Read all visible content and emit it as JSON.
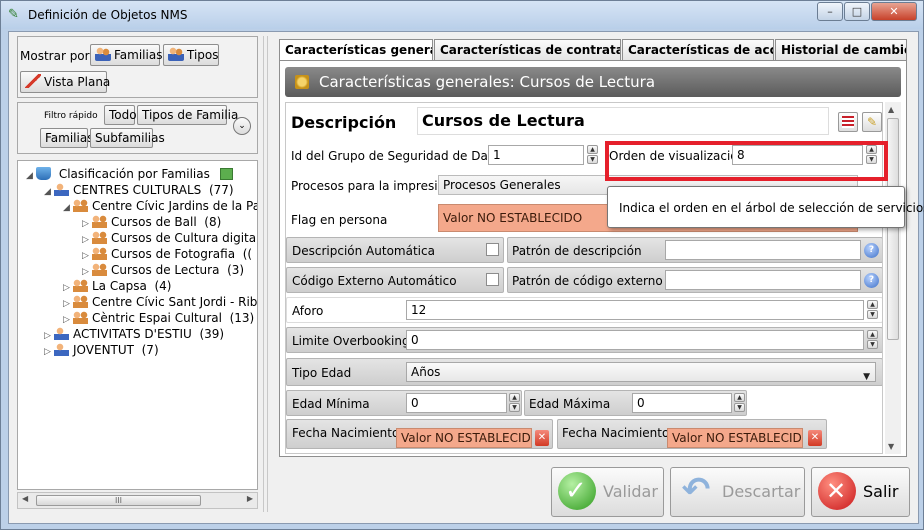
{
  "window": {
    "title": "Definición de Objetos NMS",
    "buttons": {
      "minimize": "–",
      "maximize": "□",
      "close": "✕"
    }
  },
  "left_panel": {
    "mostrar_por_label": "Mostrar por:",
    "familias_button": "Familias",
    "tipos_button": "Tipos",
    "vista_plana_button": "Vista Plana",
    "filtro_rapido_label": "Filtro rápido",
    "filter_buttons": [
      "Todo",
      "Tipos de Familia",
      "Familias",
      "Subfamilias"
    ],
    "tree": [
      {
        "label": "Clasificación por Familias",
        "count": ""
      },
      {
        "label": "CENTRES CULTURALS",
        "count": "(77)"
      },
      {
        "label": "Centre Cívic Jardins de la Pa",
        "count": ""
      },
      {
        "label": "Cursos de Ball",
        "count": "(8)"
      },
      {
        "label": "Cursos de Cultura digita",
        "count": ""
      },
      {
        "label": "Cursos de Fotografia",
        "count": "(("
      },
      {
        "label": "Cursos de Lectura",
        "count": "(3)"
      },
      {
        "label": "La Capsa",
        "count": "(4)"
      },
      {
        "label": "Centre Cívic Sant Jordi - Rib",
        "count": ""
      },
      {
        "label": "Cèntric Espai Cultural",
        "count": "(13)"
      },
      {
        "label": "ACTIVITATS D'ESTIU",
        "count": "(39)"
      },
      {
        "label": "JOVENTUT",
        "count": "(7)"
      }
    ]
  },
  "tabs": [
    "Características generales",
    "Características de contratació...",
    "Características de acceso",
    "Historial de cambios"
  ],
  "section_header": "Características generales: Cursos de Lectura",
  "form": {
    "descripcion_label": "Descripción",
    "descripcion_value": "Cursos de Lectura",
    "grupo_seguridad_label": "Id del Grupo de Seguridad de Datos",
    "grupo_seguridad_value": "1",
    "orden_label": "Orden de visualización",
    "orden_value": "8",
    "procesos_label": "Procesos para la impresión",
    "procesos_value": "Procesos Generales",
    "flag_label": "Flag en persona",
    "flag_value": "Valor NO ESTABLECIDO",
    "desc_auto_label": "Descripción Automática",
    "patron_desc_label": "Patrón de descripción",
    "cod_ext_auto_label": "Código Externo Automático",
    "patron_cod_label": "Patrón de código externo",
    "aforo_label": "Aforo",
    "aforo_value": "12",
    "limite_label": "Limite Overbooking",
    "limite_value": "0",
    "tipo_edad_label": "Tipo Edad",
    "tipo_edad_value": "Años",
    "edad_min_label": "Edad Mínima",
    "edad_min_value": "0",
    "edad_max_label": "Edad Máxima",
    "edad_max_value": "0",
    "fecha_nac_label_1": "Fecha Nacimiento",
    "fecha_nac_value_1": "Valor NO ESTABLECIDO",
    "fecha_nac_label_2": "Fecha Nacimiento",
    "fecha_nac_value_2": "Valor NO ESTABLECIDO"
  },
  "tooltip": "Indica el orden en el árbol de selección de servicios",
  "footer": {
    "validar": "Validar",
    "descartar": "Descartar",
    "salir": "Salir"
  },
  "colors": {
    "highlight_red": "#e5202b",
    "orange_field": "#f4a88b"
  }
}
